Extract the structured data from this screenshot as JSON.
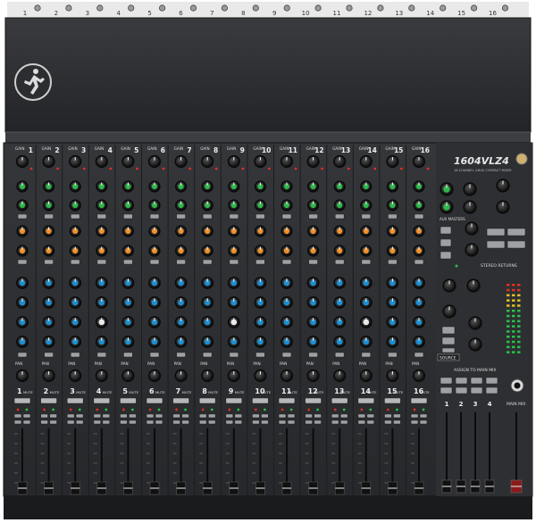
{
  "top_channel_numbers": [
    "1",
    "2",
    "3",
    "4",
    "5",
    "6",
    "7",
    "8",
    "9",
    "10",
    "11",
    "12",
    "13",
    "14",
    "15",
    "16"
  ],
  "strip_channel_numbers": [
    "1",
    "2",
    "3",
    "4",
    "5",
    "6",
    "7",
    "8",
    "9",
    "10",
    "11",
    "12",
    "13",
    "14",
    "15",
    "16"
  ],
  "gain_label": "GAIN",
  "pan_label": "PAN",
  "mute_label": "MUTE",
  "model_name": "1604VLZ4",
  "model_subtitle": "16-CHANNEL 4-BUS COMPACT MIXER",
  "brand_icon": "running-man-logo-icon",
  "aux_master_label": "AUX MASTERS",
  "stereo_returns_label": "STEREO RETURNS",
  "source_label": "SOURCE",
  "assign_label": "ASSIGN TO MAIN MIX",
  "bus_numbers": [
    "1",
    "2",
    "3",
    "4"
  ],
  "main_mix_label": "MAIN MIX",
  "colors": {
    "panel": "#2b2d30",
    "cover": "#2a2b2e",
    "aux_knob": "#2fb84a",
    "fx_knob": "#f0902a",
    "eq_knob": "#1e8fd0",
    "eq_mid_knob": "#e8e8e8"
  }
}
